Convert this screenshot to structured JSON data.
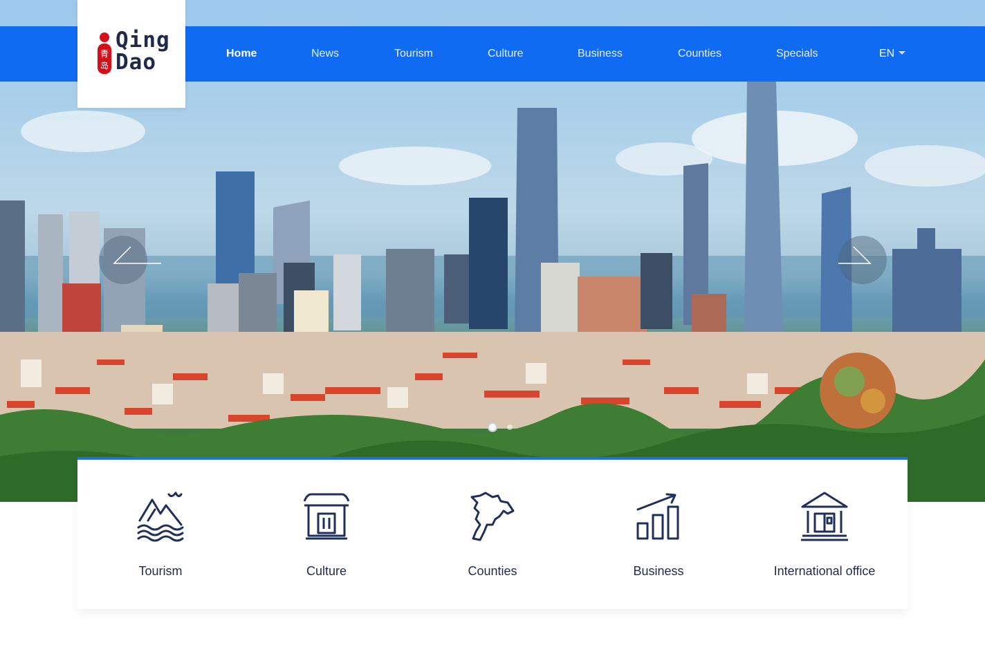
{
  "logo": {
    "line1": "Qing",
    "line2": "Dao",
    "seal_text": "青岛",
    "seal_color": "#d4101a"
  },
  "nav": {
    "items": [
      {
        "label": "Home",
        "active": true
      },
      {
        "label": "News",
        "active": false
      },
      {
        "label": "Tourism",
        "active": false
      },
      {
        "label": "Culture",
        "active": false
      },
      {
        "label": "Business",
        "active": false
      },
      {
        "label": "Counties",
        "active": false
      },
      {
        "label": "Specials",
        "active": false
      }
    ],
    "language": "EN"
  },
  "slider": {
    "prev_icon": "arrow-left-icon",
    "next_icon": "arrow-right-icon",
    "dots": 2,
    "active_dot": 1
  },
  "quick_links": [
    {
      "label": "Tourism",
      "icon": "mountain-sea-icon"
    },
    {
      "label": "Culture",
      "icon": "temple-gate-icon"
    },
    {
      "label": "Counties",
      "icon": "map-icon"
    },
    {
      "label": "Business",
      "icon": "bar-chart-growth-icon"
    },
    {
      "label": "International office",
      "icon": "government-building-icon"
    }
  ],
  "colors": {
    "nav_bg": "#0f6bf2",
    "icon_color": "#1f2f5c",
    "panel_accent": "#1f6ee8"
  }
}
